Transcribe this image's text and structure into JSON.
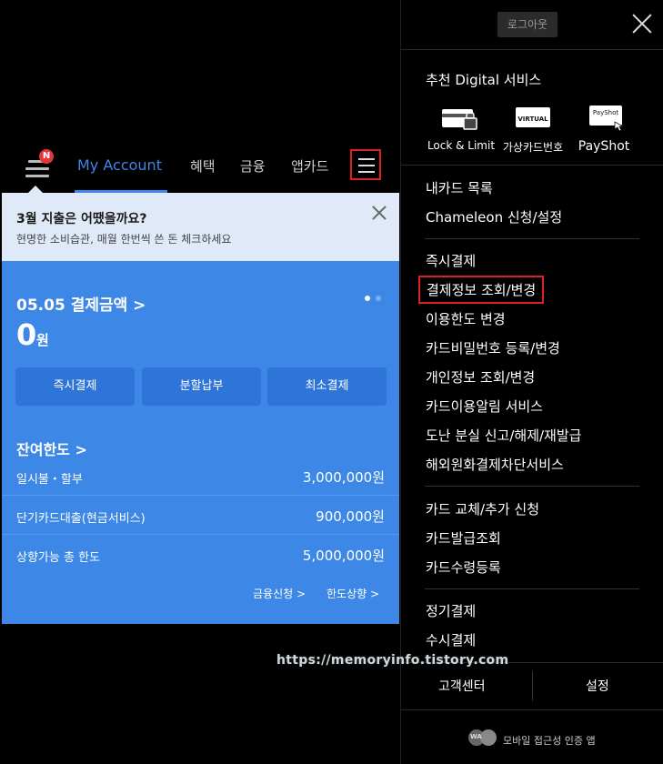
{
  "nav": {
    "badge": "N",
    "tabs": [
      "My Account",
      "혜택",
      "금융",
      "앱카드"
    ]
  },
  "promo": {
    "title": "3월 지출은 어땠을까요?",
    "subtitle": "현명한 소비습관, 매월 한번씩 쓴 돈 체크하세요"
  },
  "payment": {
    "title": "05.05 결제금액  >",
    "amount": "0",
    "unit": "원",
    "buttons": [
      "즉시결제",
      "분할납부",
      "최소결제"
    ]
  },
  "limit": {
    "title": "잔여한도 >",
    "rows": [
      {
        "label": "일시불・할부",
        "value": "3,000,000원"
      },
      {
        "label": "단기카드대출(현금서비스)",
        "value": "900,000원"
      },
      {
        "label": "상향가능 총 한도",
        "value": "5,000,000원"
      }
    ],
    "links": [
      "금융신청 >",
      "한도상향 >"
    ]
  },
  "drawer": {
    "logout": "로그아웃",
    "heading": "추천 Digital 서비스",
    "services": [
      {
        "label": "Lock & Limit",
        "icon": "card-lock-icon"
      },
      {
        "label": "가상카드번호",
        "icon": "virtual-card-icon",
        "card_text": "VIRTUAL"
      },
      {
        "label": "PayShot",
        "icon": "payshot-icon",
        "card_text": "PayShot"
      }
    ],
    "group1": [
      "내카드 목록",
      "Chameleon 신청/설정"
    ],
    "group2": [
      "즉시결제",
      "결제정보 조회/변경",
      "이용한도 변경",
      "카드비밀번호 등록/변경",
      "개인정보 조회/변경",
      "카드이용알림 서비스",
      "도난 분실 신고/해제/재발급",
      "해외원화결제차단서비스"
    ],
    "group3": [
      "카드 교체/추가 신청",
      "카드발급조회",
      "카드수령등록"
    ],
    "group4": [
      "정기결제",
      "수시결제"
    ],
    "bottom": [
      "고객센터",
      "설정"
    ],
    "access_badge": "WA",
    "accessibility": "모바일 접근성 인증 앱"
  },
  "watermark": "https://memoryinfo.tistory.com",
  "colors": {
    "accent_blue": "#3f86e8",
    "card_blue": "#3d87e6",
    "highlight_red": "#e02020",
    "badge_red": "#e5373a"
  }
}
